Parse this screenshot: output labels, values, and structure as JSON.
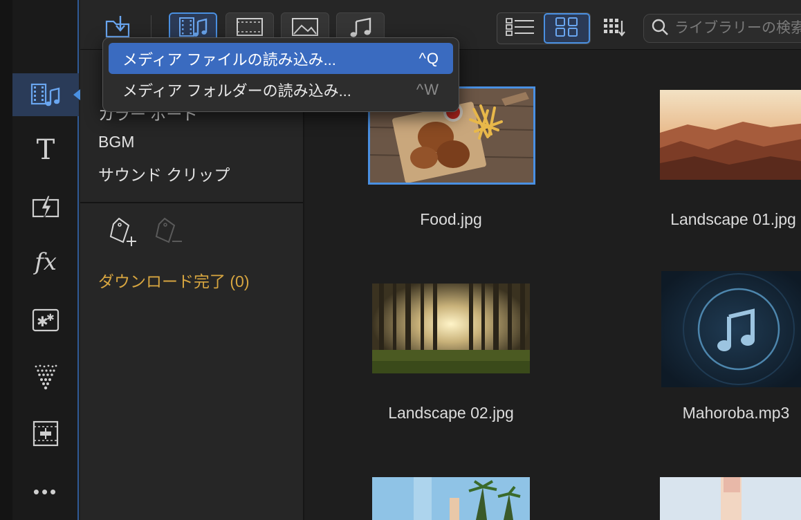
{
  "toolbar": {
    "search_placeholder": "ライブラリーの検索"
  },
  "import_menu": {
    "items": [
      {
        "label": "メディア ファイルの読み込み...",
        "shortcut": "^Q"
      },
      {
        "label": "メディア フォルダーの読み込み...",
        "shortcut": "^W"
      }
    ]
  },
  "categories": {
    "items": [
      {
        "label": "カラー ボード"
      },
      {
        "label": "BGM"
      },
      {
        "label": "サウンド クリップ"
      }
    ],
    "download_done": "ダウンロード完了 (0)"
  },
  "library": {
    "items": [
      {
        "label": "Food.jpg",
        "selected": true
      },
      {
        "label": "Landscape 01.jpg"
      },
      {
        "label": "Landscape 02.jpg"
      },
      {
        "label": "Mahoroba.mp3"
      },
      {
        "label": ""
      },
      {
        "label": ""
      }
    ]
  },
  "colors": {
    "accent": "#4a90e2",
    "menu_highlight": "#3a6bc0",
    "download_text": "#d8a640"
  },
  "icons": [
    "import-media-icon",
    "media-video-audio-icon",
    "video-filter-icon",
    "image-filter-icon",
    "audio-filter-icon",
    "list-view-icon",
    "grid-view-icon",
    "sort-icon",
    "search-icon",
    "title-icon",
    "transition-icon",
    "fx-icon",
    "pip-object-icon",
    "particle-icon",
    "subtitle-icon",
    "more-icon",
    "add-tag-icon",
    "remove-tag-icon",
    "collapse-chevron-icon",
    "music-note-icon"
  ]
}
